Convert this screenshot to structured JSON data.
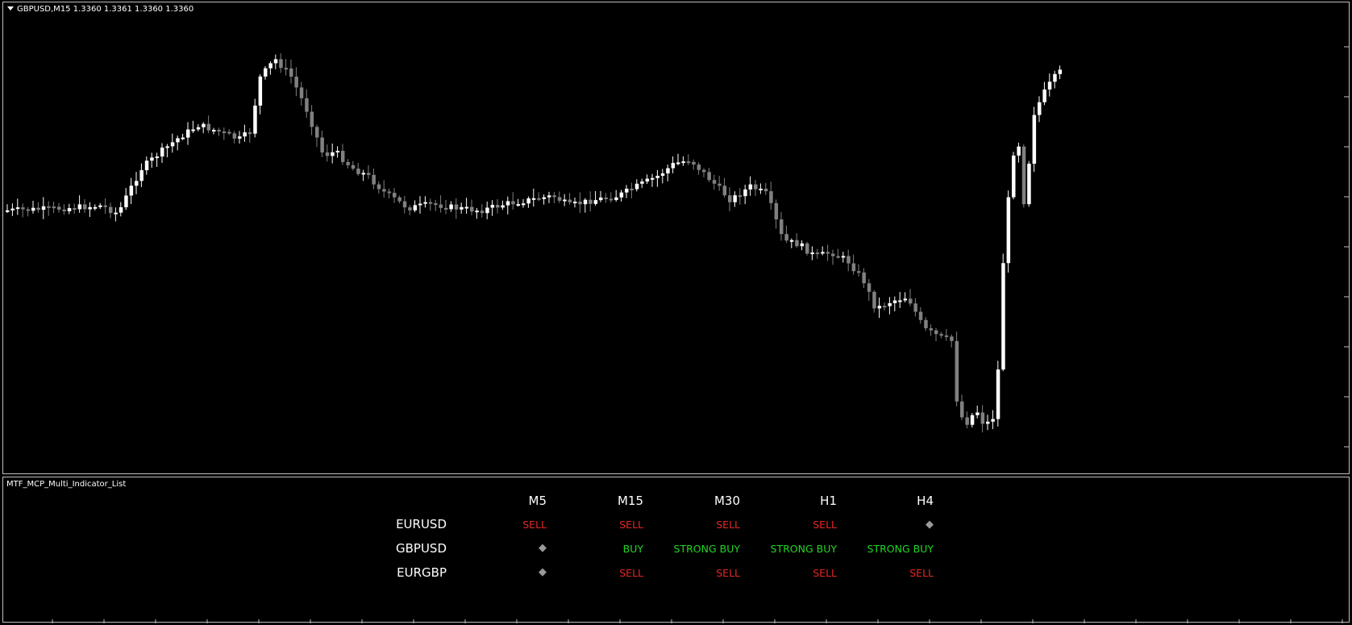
{
  "chart": {
    "title": "GBPUSD,M15  1.3360 1.3361 1.3360 1.3360"
  },
  "indicator": {
    "title": "MTF_MCP_Multi_Indicator_List",
    "timeframes": [
      "M5",
      "M15",
      "M30",
      "H1",
      "H4"
    ],
    "rows": [
      {
        "symbol": "EURUSD",
        "signals": [
          "SELL",
          "SELL",
          "SELL",
          "SELL",
          "◆"
        ]
      },
      {
        "symbol": "GBPUSD",
        "signals": [
          "◆",
          "BUY",
          "STRONG BUY",
          "STRONG BUY",
          "STRONG BUY"
        ]
      },
      {
        "symbol": "EURGBP",
        "signals": [
          "◆",
          "SELL",
          "SELL",
          "SELL",
          "SELL"
        ]
      }
    ],
    "colors": {
      "sell": "#e32727",
      "buy": "#22d622",
      "neutral": "#9a9a9a"
    }
  }
}
